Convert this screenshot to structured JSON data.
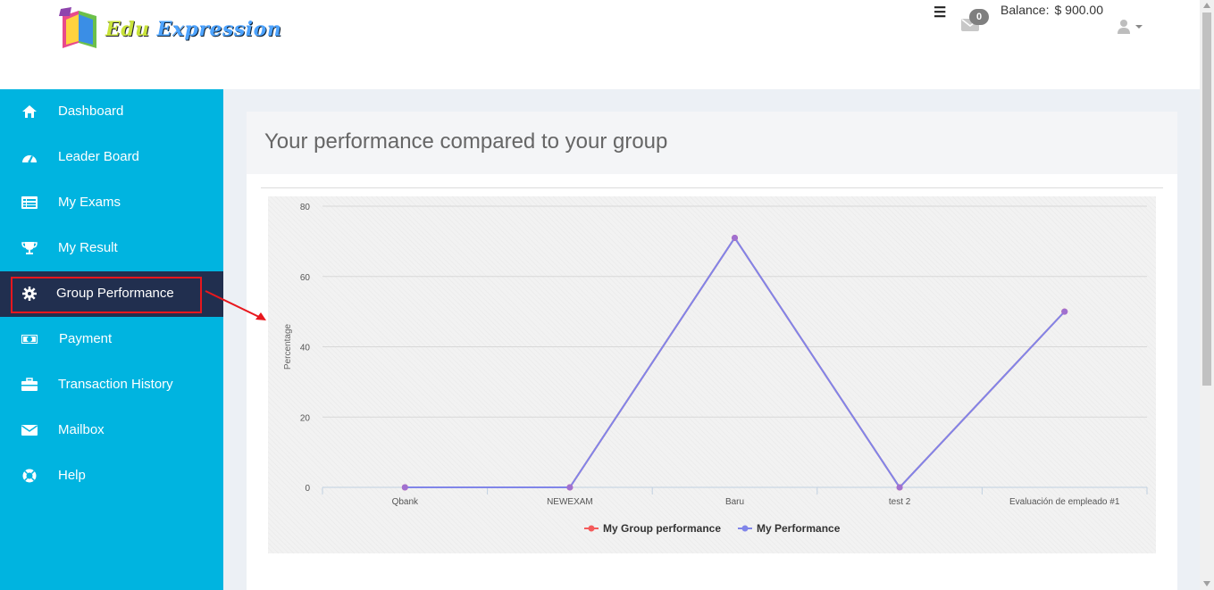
{
  "header": {
    "logo_word1": "Edu",
    "logo_word2": "Expression",
    "menu_icon": "hamburger-icon",
    "mail_count": "0",
    "balance_label": "Balance:",
    "balance_value": "$ 900.00",
    "user_icon": "user-icon"
  },
  "sidebar": {
    "items": [
      {
        "label": "Dashboard",
        "icon": "home-icon"
      },
      {
        "label": "Leader Board",
        "icon": "dashboard-icon"
      },
      {
        "label": "My Exams",
        "icon": "list-icon"
      },
      {
        "label": "My Result",
        "icon": "trophy-icon"
      },
      {
        "label": "Group Performance",
        "icon": "gear-icon",
        "active": true
      },
      {
        "label": "Payment",
        "icon": "money-icon"
      },
      {
        "label": "Transaction History",
        "icon": "briefcase-icon"
      },
      {
        "label": "Mailbox",
        "icon": "envelope-icon"
      },
      {
        "label": "Help",
        "icon": "life-ring-icon"
      }
    ]
  },
  "panel": {
    "title": "Your performance compared to your group"
  },
  "colors": {
    "sidebar_bg": "#00b4e0",
    "sidebar_active_bg": "#212f4f",
    "highlight_red": "#e8171d",
    "series_group": "#f45b5b",
    "series_mine": "#8085e9",
    "marker_mine": "#a070d0"
  },
  "chart_data": {
    "type": "line",
    "categories": [
      "Qbank",
      "NEWEXAM",
      "Baru",
      "test 2",
      "Evaluación de empleado #1"
    ],
    "series": [
      {
        "name": "My Group performance",
        "values": [
          0,
          0,
          71,
          0,
          50
        ]
      },
      {
        "name": "My Performance",
        "values": [
          0,
          0,
          71,
          0,
          50
        ]
      }
    ],
    "ylabel": "Percentage",
    "ylim": [
      0,
      80
    ],
    "yticks": [
      0,
      20,
      40,
      60,
      80
    ],
    "grid": true,
    "legend": "bottom"
  }
}
